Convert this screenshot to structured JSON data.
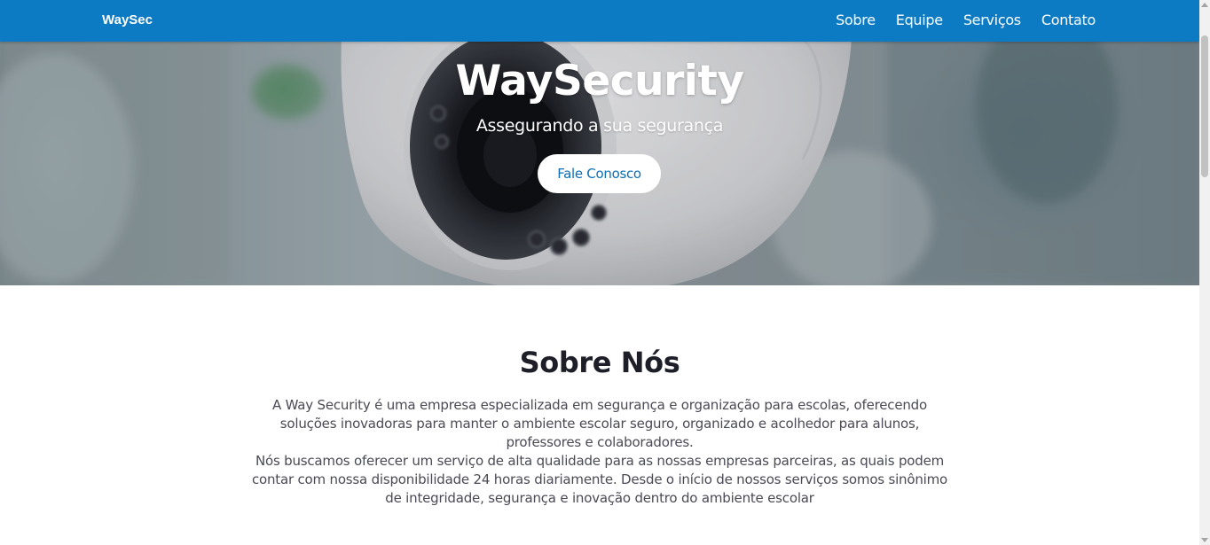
{
  "navbar": {
    "brand": "WaySec",
    "links": [
      "Sobre",
      "Equipe",
      "Serviços",
      "Contato"
    ]
  },
  "hero": {
    "title": "WaySecurity",
    "subtitle": "Assegurando a sua segurança",
    "button_label": "Fale Conosco",
    "background_icon": "security-camera-photo"
  },
  "about": {
    "title": "Sobre Nós",
    "paragraphs": [
      "A Way Security é uma empresa especializada em segurança e organização para escolas, oferecendo soluções inovadoras para manter o ambiente escolar seguro, organizado e acolhedor para alunos, professores e colaboradores.",
      "Nós buscamos oferecer um serviço de alta qualidade para as nossas empresas parceiras, as quais podem contar com nossa disponibilidade 24 horas diariamente. Desde o início de nossos serviços somos sinônimo de integridade, segurança e inovação dentro do ambiente escolar"
    ]
  },
  "colors": {
    "navbar_bg": "#0c7bc4",
    "hero_text": "#ffffff",
    "button_text": "#0c6fb3",
    "heading_text": "#1e1e28",
    "body_text": "#4a4a55"
  }
}
